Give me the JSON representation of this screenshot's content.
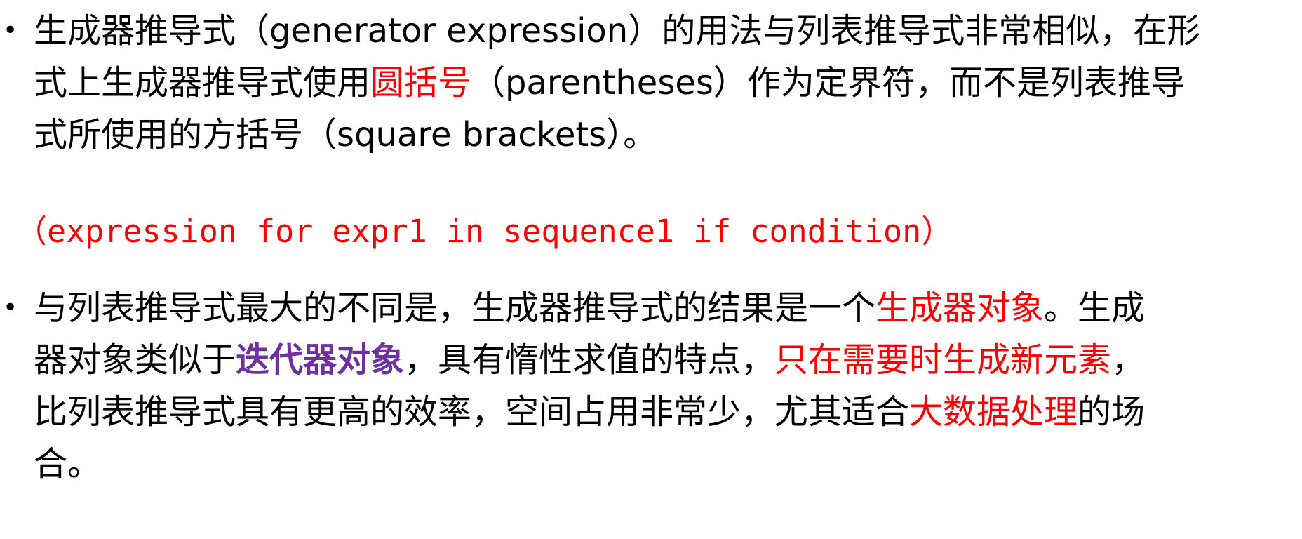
{
  "bullet_symbol": "•",
  "colors": {
    "text": "#000000",
    "highlight_red": "#ff0000",
    "highlight_purple": "#7030a0"
  },
  "paragraph1": {
    "line1": "生成器推导式（generator expression）的用法与列表推导式非常相似，在形",
    "line2_a": "式上生成器推导式使用",
    "line2_red": "圆括号",
    "line2_b": "（parentheses）作为定界符，而不是列表推导",
    "line3": "式所使用的方括号（square brackets）。"
  },
  "code_line": "（expression for expr1 in sequence1 if condition）",
  "paragraph2": {
    "line1_a": "与列表推导式最大的不同是，生成器推导式的结果是一个",
    "line1_red": "生成器对象",
    "line1_b": "。生成",
    "line2_a": "器对象类似于",
    "line2_purple": "迭代器对象",
    "line2_b": "，具有惰性求值的特点，",
    "line2_red": "只在需要时生成新元素",
    "line2_c": "，",
    "line3_a": "比列表推导式具有更高的效率，空间占用非常少，尤其适合",
    "line3_red": "大数据处理",
    "line3_b": "的场",
    "line4": "合。"
  }
}
